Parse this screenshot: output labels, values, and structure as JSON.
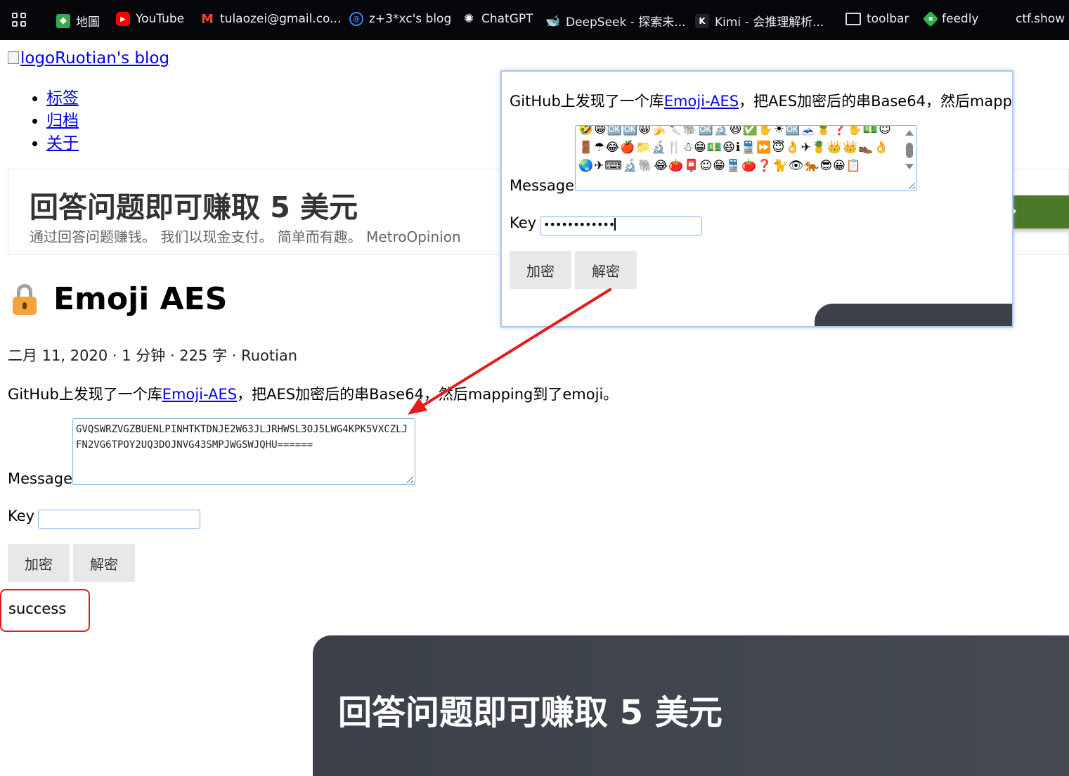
{
  "bookmarks": [
    {
      "label": "地圖",
      "icon": "maps-icon"
    },
    {
      "label": "YouTube",
      "icon": "youtube-icon"
    },
    {
      "label": "tulaozei@gmail.co...",
      "icon": "gmail-icon"
    },
    {
      "label": "z+3*xc's blog",
      "icon": "blog-icon"
    },
    {
      "label": "ChatGPT",
      "icon": "chatgpt-icon"
    },
    {
      "label": "DeepSeek - 探索未...",
      "icon": "deepseek-icon"
    },
    {
      "label": "Kimi - 会推理解析...",
      "icon": "kimi-icon"
    },
    {
      "label": "toolbar",
      "icon": "folder-icon"
    },
    {
      "label": "feedly",
      "icon": "feedly-icon"
    },
    {
      "label": "ctf.show",
      "icon": ""
    }
  ],
  "site": {
    "logo_alt": "logo",
    "name": "Ruotian's blog",
    "nav": [
      "标签",
      "归档",
      "关于"
    ]
  },
  "ad": {
    "title": "回答问题即可赚取 5 美元",
    "subtitle": "通过回答问题赚钱。 我们以现金支付。 简单而有趣。 MetroOpinion",
    "arrow": "›",
    "bottom_title": "回答问题即可赚取 5 美元"
  },
  "post": {
    "title": "Emoji AES",
    "meta": "二月 11, 2020 · 1 分钟 · 225 字 · Ruotian",
    "intro_before": "GitHub上发现了一个库",
    "intro_link": "Emoji-AES",
    "intro_after": "，把AES加密后的串Base64，然后mapping到了emoji。"
  },
  "form": {
    "message_label": "Message",
    "key_label": "Key",
    "message_value": "GVQSWRZVGZBUENLPINHTKTDNJE2W63JLJRHWSL3OJ5LWG4KPK5VXCZLJFN2VG6TPOY2UQ3DOJNVG43SMPJWGSWJQHU======",
    "key_value": "",
    "encrypt_label": "加密",
    "decrypt_label": "解密",
    "result": "success"
  },
  "popup": {
    "intro_before": "GitHub上发现了一个库",
    "intro_link": "Emoji-AES",
    "intro_after": "，把AES加密后的串Base64，然后mapp",
    "message_label": "Message",
    "message_value": "🤣😁🆗🆗😀🍌🔪🐘🆗🔬😆✅✋☀🆗🗻🍍❓✋💵☺🚪☂😂🍎📁🔬🍴☃😁💵😆ℹ🚆⏩😇👌✈🍍👑👑👞👌🌏✈⌨🔬🐘😂🍅📮☺😁🚆🍅❓🐈👁🐅😎😀📋",
    "key_label": "Key",
    "key_value": "••••••••••••",
    "encrypt_label": "加密",
    "decrypt_label": "解密"
  },
  "colors": {
    "annotation_red": "#e51c1c",
    "link_blue": "#0000ee",
    "bookmarks_bg": "#05070b",
    "ad_green": "#4a7a28",
    "dark_ad_bg": "#3b4049"
  }
}
